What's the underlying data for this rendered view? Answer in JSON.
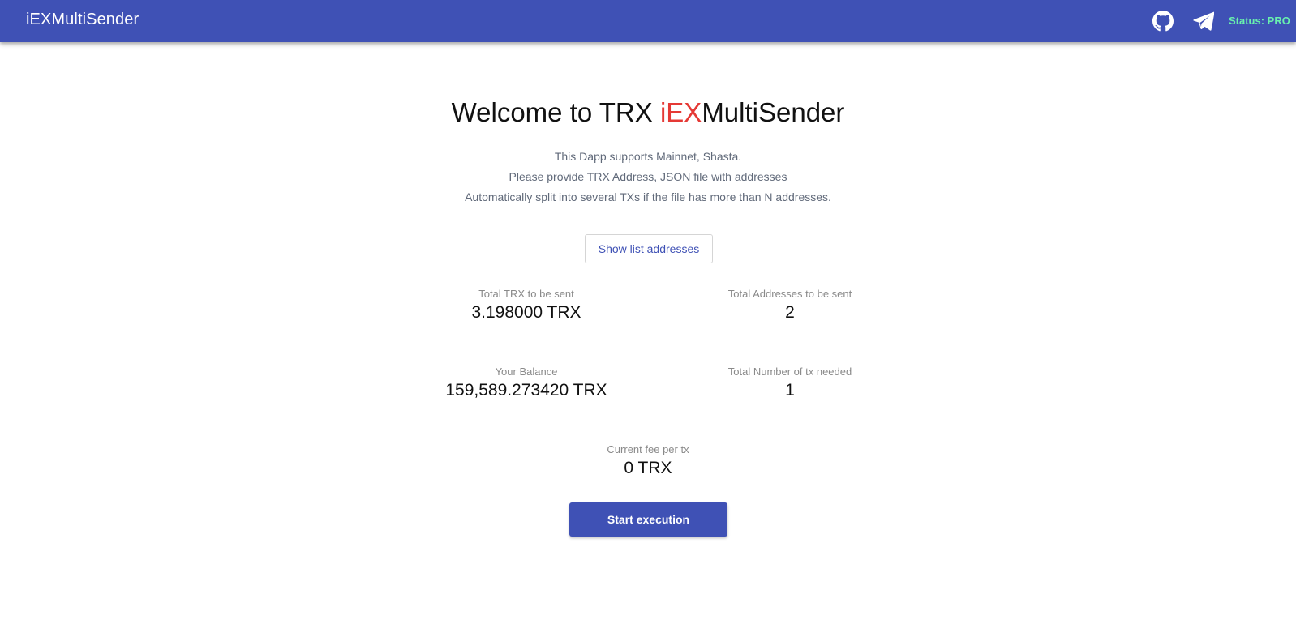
{
  "header": {
    "brand": "iEXMultiSender",
    "status_text": "Status: PRO",
    "icons": [
      "github-icon",
      "telegram-icon"
    ]
  },
  "hero": {
    "title_prefix": "Welcome to TRX ",
    "title_accent": "iEX",
    "title_suffix": "MultiSender",
    "lines": [
      "This Dapp supports Mainnet, Shasta.",
      "Please provide TRX Address, JSON file with addresses",
      "Automatically split into several TXs if the file has more than N addresses."
    ]
  },
  "show_list_label": "Show list addresses",
  "stats": {
    "total_trx": {
      "label": "Total TRX to be sent",
      "value": "3.198000 TRX"
    },
    "total_addresses": {
      "label": "Total Addresses to be sent",
      "value": "2"
    },
    "balance": {
      "label": "Your Balance",
      "value": "159,589.273420 TRX"
    },
    "tx_needed": {
      "label": "Total Number of tx needed",
      "value": "1"
    },
    "fee": {
      "label": "Current fee per tx",
      "value": "0 TRX"
    }
  },
  "start_label": "Start execution",
  "colors": {
    "primary": "#3f51b5",
    "accent_red": "#e53935",
    "status_green": "#69f0ae"
  }
}
